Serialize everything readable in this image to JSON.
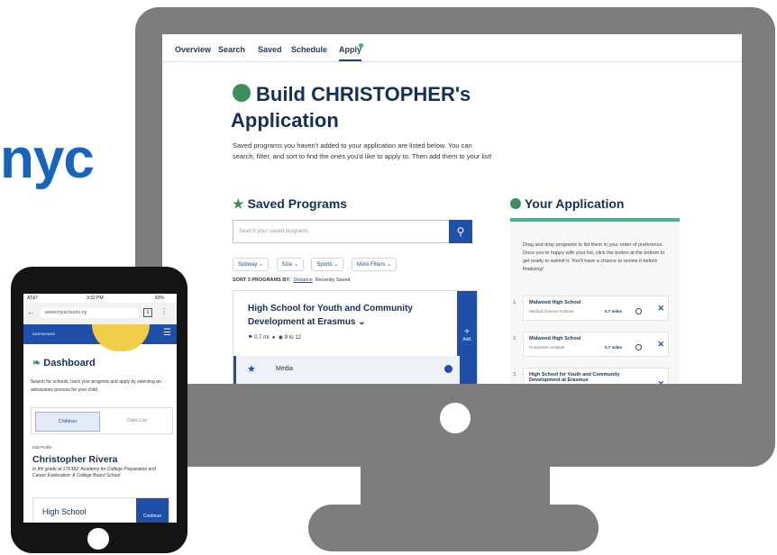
{
  "brand": "nyc",
  "nav": {
    "tabs": [
      "Overview",
      "Search",
      "Saved",
      "Schedule",
      "Apply"
    ]
  },
  "heading": {
    "line1": "Build CHRISTOPHER's",
    "line2": "Application",
    "description": "Saved programs you haven't added to your application are listed below. You can search, filter, and sort to find the ones you'd like to apply to. Then add them to your list!"
  },
  "saved": {
    "title": "Saved Programs",
    "search_placeholder": "Search your saved programs",
    "filters": [
      "Subway ⌄",
      "Size ⌄",
      "Sports ⌄",
      "More Filters ⌄"
    ],
    "sort_label": "SORT 3 PROGRAMS BY:",
    "sort_distance": "Distance",
    "sort_recent": "Recently Saved",
    "card": {
      "title": "High School for Youth and Community Development at Erasmus ⌄",
      "distance": "0.7 mi",
      "grades": "9 to 12",
      "add_label": "Add",
      "program": "Media"
    }
  },
  "application": {
    "title": "Your Application",
    "instructions": "Drag and drop programs to list them in your order of preference. Once you're happy with your list, click the button at the bottom to get ready to submit it. You'll have a chance to review it before finalizing!",
    "items": [
      {
        "num": "1.",
        "school": "Midwood High School",
        "program": "Medical Science Institute",
        "distance": "0.7 miles"
      },
      {
        "num": "2.",
        "school": "Midwood High School",
        "program": "Humanities Institute",
        "distance": "0.7 miles"
      },
      {
        "num": "3.",
        "school": "High School for Youth and Community Development at Erasmus",
        "program": "",
        "distance": ""
      }
    ]
  },
  "phone": {
    "carrier": "AT&T",
    "time": "3:32 PM",
    "battery": "83%",
    "url": "www.myschools.ny",
    "tab_count": "1",
    "dashboard_small": "DASHBOARD",
    "dashboard_title": "Dashboard",
    "dashboard_desc": "Search for schools, track your progress and apply by selecting an admissions process for your child.",
    "tab_children": "Children",
    "tab_dates": "Date List",
    "edit_profile": "Edit Profile",
    "student_name": "Christopher Rivera",
    "student_desc": "In 8th grade at 17K382: Academy for College Preparation and Career Exploration: A College Board School",
    "card_label": "High School",
    "continue": "Continue"
  }
}
